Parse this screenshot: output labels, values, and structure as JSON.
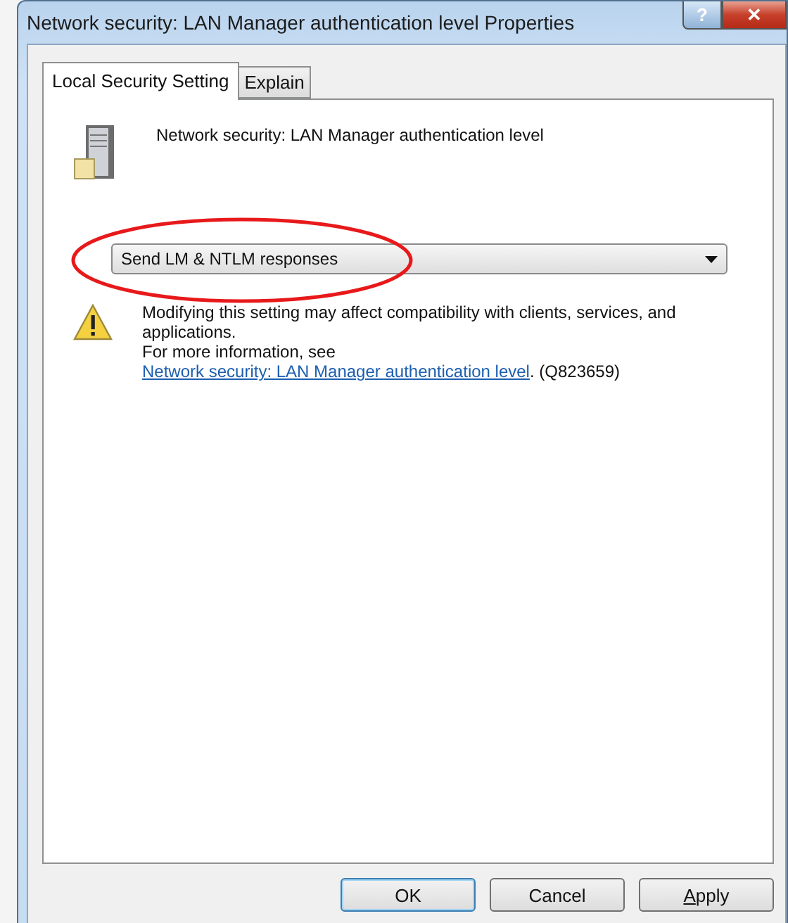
{
  "window": {
    "title": "Network security: LAN Manager authentication level Properties"
  },
  "title_buttons": [
    {
      "kind": "help",
      "label": "?"
    },
    {
      "kind": "close",
      "label": "✕"
    }
  ],
  "tabs": [
    {
      "label": "Local Security Setting",
      "selected": true
    },
    {
      "label": "Explain",
      "selected": false
    }
  ],
  "policy": {
    "name": "Network security: LAN Manager authentication level"
  },
  "dropdown": {
    "value": "Send LM & NTLM responses",
    "highlighted": true
  },
  "warning": {
    "text": "Modifying this setting may affect compatibility with clients, services, and applications.",
    "more_prefix": "For more information, see ",
    "link": "Network security: LAN Manager authentication level",
    "more_suffix": ". (Q823659)"
  },
  "buttons": [
    {
      "label": "OK",
      "default": true
    },
    {
      "label": "Cancel",
      "default": false
    },
    {
      "label": "Apply",
      "default": false,
      "underline_first": true
    }
  ]
}
